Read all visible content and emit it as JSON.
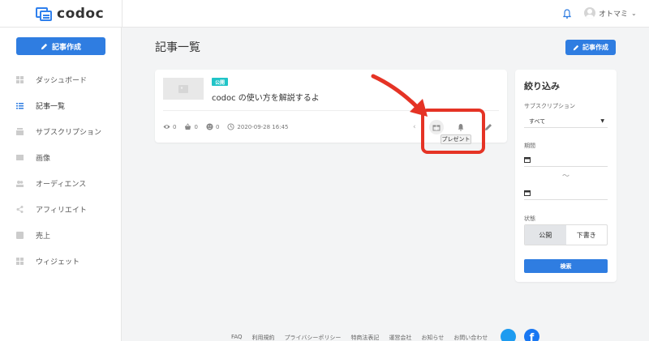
{
  "app": {
    "logo_text": "codoc"
  },
  "header": {
    "user_name": "オトマミ",
    "bell_icon": "bell-icon",
    "chevron": "⌄"
  },
  "sidebar": {
    "create_label": "記事作成",
    "items": [
      {
        "label": "ダッシュボード",
        "icon": "dashboard-icon"
      },
      {
        "label": "記事一覧",
        "icon": "list-icon",
        "active": true
      },
      {
        "label": "サブスクリプション",
        "icon": "subscription-icon"
      },
      {
        "label": "画像",
        "icon": "image-icon"
      },
      {
        "label": "オーディエンス",
        "icon": "audience-icon"
      },
      {
        "label": "アフィリエイト",
        "icon": "share-icon"
      },
      {
        "label": "売上",
        "icon": "sales-icon"
      },
      {
        "label": "ウィジェット",
        "icon": "widget-icon"
      }
    ]
  },
  "main": {
    "title": "記事一覧",
    "create_label": "記事作成",
    "posts": [
      {
        "status": "公開",
        "title": "codoc の使い方を解説するよ",
        "views": "0",
        "purchases": "0",
        "supporters": "0",
        "date": "2020-09-28 16:45",
        "tooltip": "プレゼント"
      }
    ]
  },
  "filter": {
    "title": "絞り込み",
    "subscription_label": "サブスクリプション",
    "subscription_value": "すべて",
    "period_label": "期間",
    "period_sep": "〜",
    "status_label": "状態",
    "status_options": [
      "公開",
      "下書き"
    ],
    "status_selected": "公開",
    "search_label": "検索"
  },
  "footer": {
    "links": [
      "FAQ",
      "利用規約",
      "プライバシーポリシー",
      "特商法表記",
      "運営会社",
      "お知らせ",
      "お問い合わせ"
    ]
  },
  "colors": {
    "accent": "#2f7de1",
    "badge": "#20c4c7",
    "highlight": "#e53325"
  }
}
